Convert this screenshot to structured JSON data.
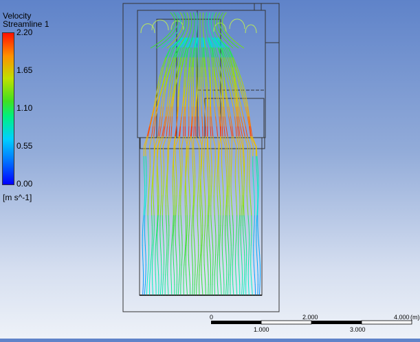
{
  "legend": {
    "title": "Velocity",
    "subtitle": "Streamline 1",
    "unit": "[m s^-1]",
    "max": 2.2,
    "ticks": [
      {
        "value": 2.2,
        "label": "2.20"
      },
      {
        "value": 1.65,
        "label": "1.65"
      },
      {
        "value": 1.1,
        "label": "1.10"
      },
      {
        "value": 0.55,
        "label": "0.55"
      },
      {
        "value": 0.0,
        "label": "0.00"
      }
    ],
    "colormap": [
      "#0000ff",
      "#00a0ff",
      "#00f0d0",
      "#30e030",
      "#a0e000",
      "#f0c000",
      "#ff6000",
      "#ff0000"
    ]
  },
  "scale_bar": {
    "top_labels": [
      "0",
      "2.000",
      "4.000"
    ],
    "unit": "(m)",
    "bottom_labels": [
      "1.000",
      "3.000"
    ]
  },
  "colors": {
    "outline": "#333333",
    "background_top": "#5f83c9",
    "background_bottom": "#eef2f8"
  }
}
